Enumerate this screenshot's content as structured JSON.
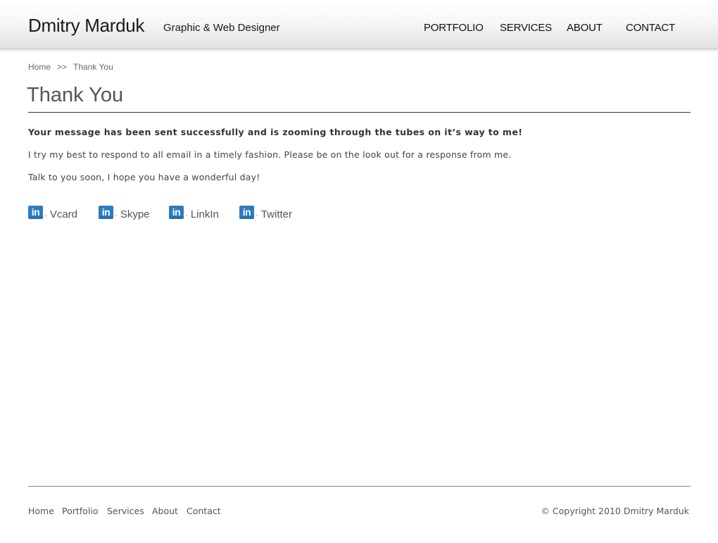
{
  "header": {
    "name": "Dmitry Marduk",
    "tagline": "Graphic & Web Designer",
    "nav": [
      "PORTFOLIO",
      "SERVICES",
      "ABOUT",
      "CONTACT"
    ]
  },
  "breadcrumb": {
    "home": "Home",
    "separator": ">>",
    "current": "Thank You"
  },
  "page": {
    "title": "Thank You",
    "lead": "Your message has been sent successfully and is zooming through the tubes on it’s way to me!",
    "line2": "I try my best to respond to all email in a timely fashion. Please be on the look out for a response from me.",
    "line3": "Talk to you soon, I hope you have a wonderful day!"
  },
  "social": {
    "icon_text": "in",
    "icon": "linkedin-icon",
    "icon_color": "#2f7bc0",
    "links": [
      "Vcard",
      "Skype",
      "LinkIn",
      "Twitter"
    ]
  },
  "footer": {
    "nav": [
      "Home",
      "Portfolio",
      "Services",
      "About",
      "Contact"
    ],
    "copyright": "© Copyright 2010 Dmitry Marduk"
  }
}
